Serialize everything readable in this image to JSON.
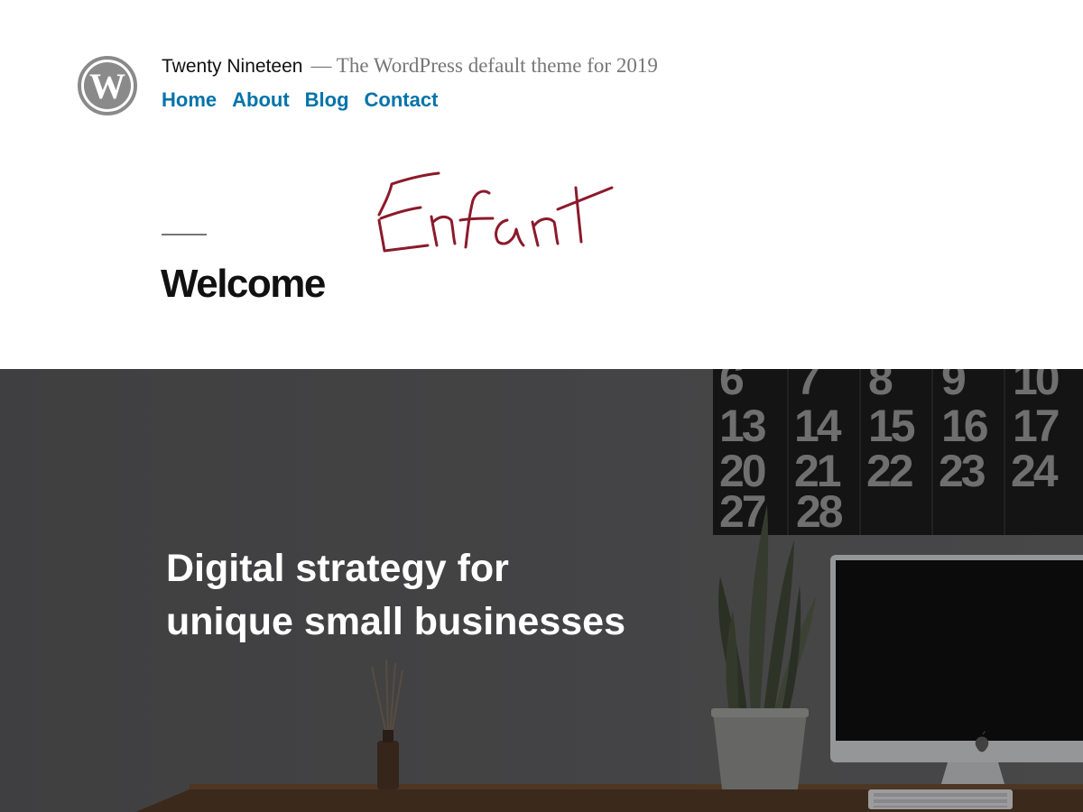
{
  "header": {
    "site_title": "Twenty Nineteen",
    "separator": "—",
    "description": "The WordPress default theme for 2019",
    "logo_icon": "wordpress-logo-icon",
    "nav": [
      {
        "label": "Home"
      },
      {
        "label": "About"
      },
      {
        "label": "Blog"
      },
      {
        "label": "Contact"
      }
    ],
    "link_color": "#0073aa"
  },
  "entry": {
    "title": "Welcome",
    "annotation": "Enfant",
    "annotation_color": "#8b1a2b"
  },
  "cover": {
    "heading_line1": "Digital strategy for",
    "heading_line2": "unique small businesses",
    "calendar_numbers": [
      [
        "6",
        "7",
        "8",
        "9",
        "10"
      ],
      [
        "13",
        "14",
        "15",
        "16",
        "17"
      ],
      [
        "20",
        "21",
        "22",
        "23",
        "24"
      ],
      [
        "27",
        "28"
      ]
    ],
    "apple_icon": "apple-logo-icon"
  }
}
